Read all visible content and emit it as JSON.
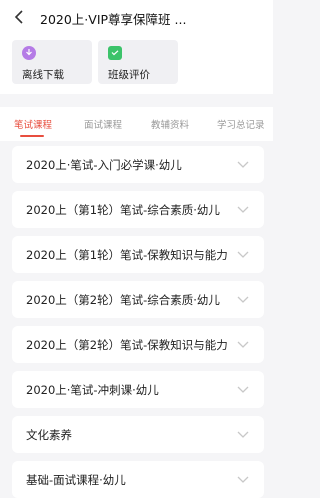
{
  "header": {
    "title": "2020上·VIP尊享保障班 ...",
    "back_icon": "chevron-left-icon"
  },
  "tools": [
    {
      "label": "离线下载",
      "icon": "download-icon",
      "color": "#b57be6"
    },
    {
      "label": "班级评价",
      "icon": "chat-icon",
      "color": "#3cc36a"
    }
  ],
  "tabs": [
    {
      "label": "笔试课程",
      "active": true
    },
    {
      "label": "面试课程",
      "active": false
    },
    {
      "label": "教辅资料",
      "active": false
    },
    {
      "label": "学习总记录",
      "active": false
    }
  ],
  "courses": [
    {
      "label": "2020上·笔试-入门必学课·幼儿"
    },
    {
      "label": "2020上（第1轮）笔试-综合素质·幼儿"
    },
    {
      "label": "2020上（第1轮）笔试-保教知识与能力"
    },
    {
      "label": "2020上（第2轮）笔试-综合素质·幼儿"
    },
    {
      "label": "2020上（第2轮）笔试-保教知识与能力"
    },
    {
      "label": "2020上·笔试-冲刺课·幼儿"
    },
    {
      "label": "文化素养"
    },
    {
      "label": "基础-面试课程·幼儿"
    }
  ],
  "colors": {
    "accent": "#e84e3f",
    "background": "#f5f5f7"
  }
}
